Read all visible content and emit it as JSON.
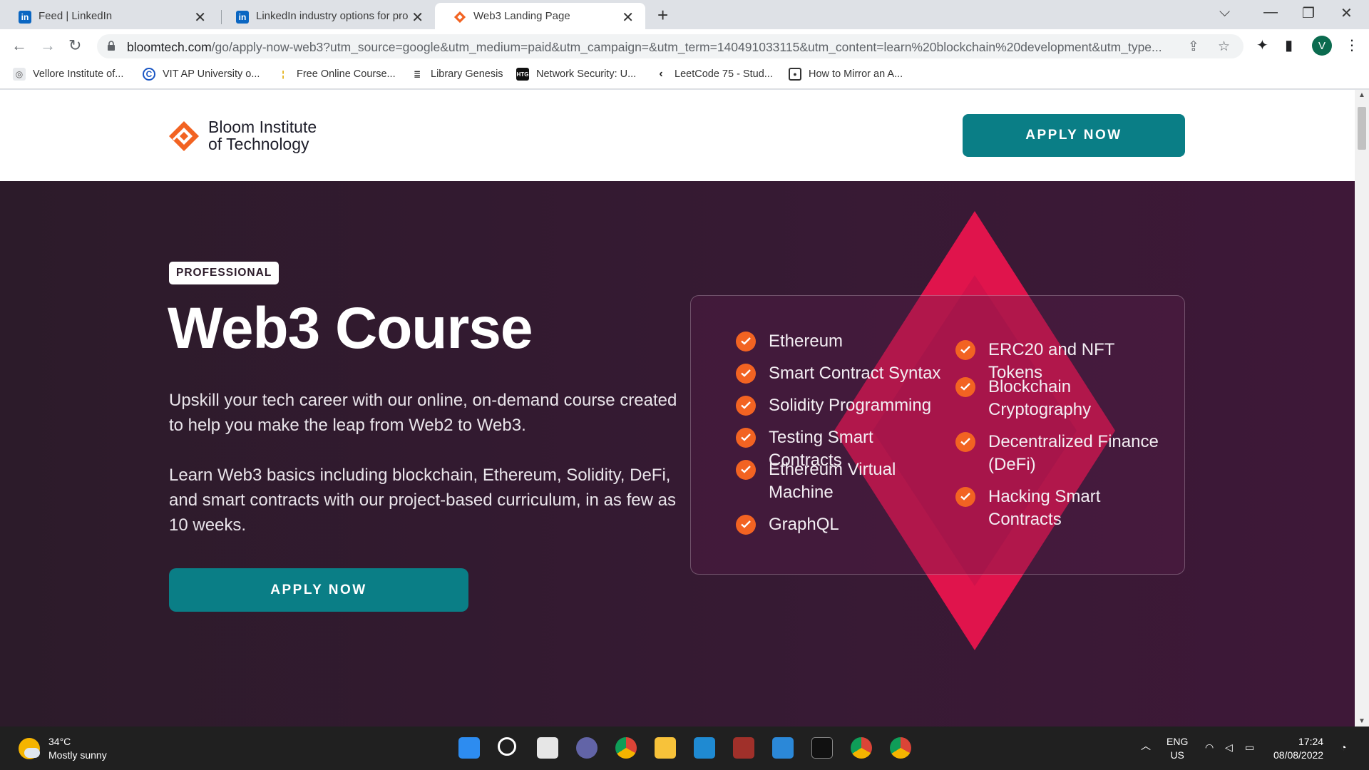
{
  "browser": {
    "tabs": [
      {
        "label": "Feed | LinkedIn",
        "favicon": "linkedin-icon"
      },
      {
        "label": "LinkedIn industry options for pro",
        "favicon": "linkedin-icon"
      },
      {
        "label": "Web3 Landing Page",
        "favicon": "bloom-icon",
        "active": true
      }
    ],
    "url_domain": "bloomtech.com",
    "url_path": "/go/apply-now-web3?utm_source=google&utm_medium=paid&utm_campaign=&utm_term=140491033115&utm_content=learn%20blockchain%20development&utm_type...",
    "profile_initial": "V",
    "bookmarks": [
      {
        "label": "Vellore Institute of...",
        "icon": "vit-icon"
      },
      {
        "label": "VIT AP University o...",
        "icon": "vitap-icon"
      },
      {
        "label": "Free Online Course...",
        "icon": "course-icon"
      },
      {
        "label": "Library Genesis",
        "icon": "libgen-icon"
      },
      {
        "label": "Network Security: U...",
        "icon": "htg-icon",
        "icon_text": "HTG"
      },
      {
        "label": "LeetCode 75 - Stud...",
        "icon": "leetcode-icon"
      },
      {
        "label": "How to Mirror an A...",
        "icon": "mirror-icon"
      }
    ]
  },
  "page": {
    "logo_line1": "Bloom Institute",
    "logo_line2": "of Technology",
    "header_cta": "APPLY NOW",
    "badge": "PROFESSIONAL",
    "title": "Web3 Course",
    "paragraph1": "Upskill your tech career with our online, on-demand course created to help you make the leap from Web2 to Web3.",
    "paragraph2": "Learn Web3 basics including blockchain, Ethereum, Solidity, DeFi, and smart contracts with our project-based curriculum, in as few as 10 weeks.",
    "hero_cta": "APPLY NOW",
    "topics_left": [
      "Ethereum",
      "Smart Contract Syntax",
      "Solidity Programming",
      "Testing Smart Contracts",
      "Ethereum Virtual Machine",
      "GraphQL"
    ],
    "topics_right": [
      "ERC20 and NFT Tokens",
      "Blockchain Cryptography",
      "Decentralized Finance (DeFi)",
      "Hacking Smart Contracts"
    ]
  },
  "taskbar": {
    "temperature": "34°C",
    "weather": "Mostly sunny",
    "lang": "ENG",
    "region": "US",
    "time": "17:24",
    "date": "08/08/2022"
  },
  "colors": {
    "accent_teal": "#0a7e86",
    "brand_orange": "#f26322",
    "hero_bg": "#2c1b2a",
    "diamond_pink": "#e0144c"
  }
}
